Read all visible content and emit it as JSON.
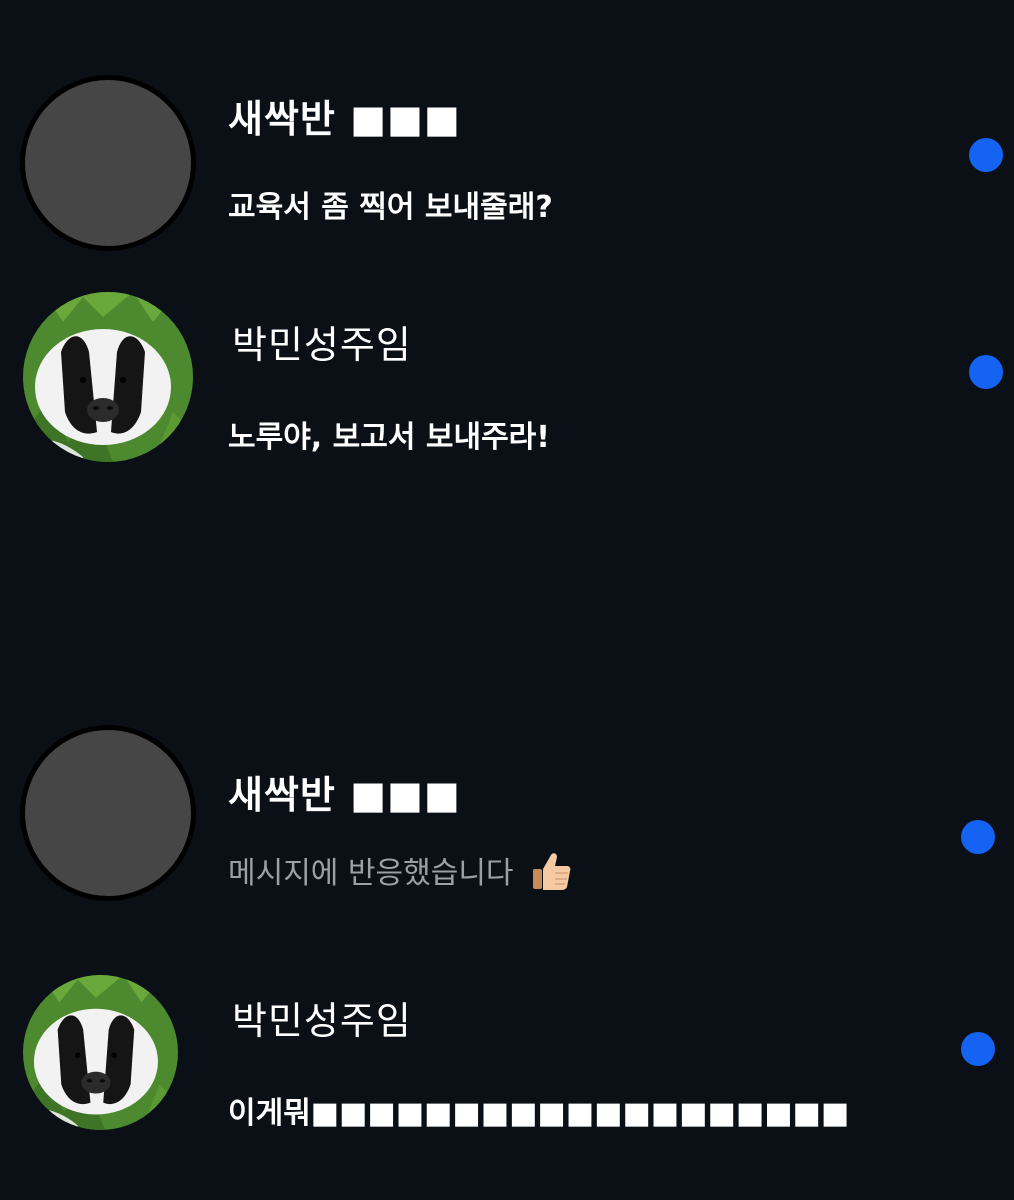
{
  "colors": {
    "background": "#0b1016",
    "unread_dot": "#1463f3",
    "placeholder_avatar": "#464646"
  },
  "conversations": [
    {
      "name": "새싹반 ■■■",
      "preview": "교육서 좀 찍어 보내줄래?",
      "avatar": "gray-placeholder",
      "unread": true
    },
    {
      "name": "박민성주임",
      "preview": "노루야, 보고서 보내주라!",
      "avatar": "badger-photo",
      "unread": true
    },
    {
      "name": "새싹반 ■■■",
      "preview": "메시지에 반응했습니다",
      "preview_icon": "thumbs-up-icon",
      "avatar": "gray-placeholder",
      "unread": true
    },
    {
      "name": "박민성주임",
      "preview": "이게뭐■■■■■■■■■■■■■■■■■■■",
      "avatar": "badger-photo",
      "unread": true
    }
  ]
}
